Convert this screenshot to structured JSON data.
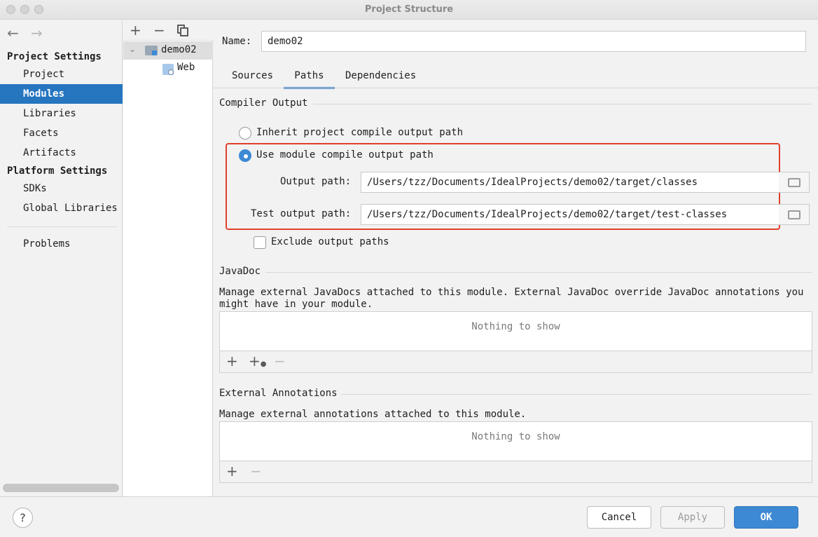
{
  "window": {
    "title": "Project Structure"
  },
  "sidebar": {
    "project_settings_heading": "Project Settings",
    "project_items": [
      "Project",
      "Modules",
      "Libraries",
      "Facets",
      "Artifacts"
    ],
    "platform_settings_heading": "Platform Settings",
    "platform_items": [
      "SDKs",
      "Global Libraries"
    ],
    "problems_label": "Problems",
    "selected": "Modules"
  },
  "module_tree": {
    "root": "demo02",
    "child": "Web"
  },
  "main": {
    "name_label": "Name:",
    "name_value": "demo02",
    "tabs": [
      "Sources",
      "Paths",
      "Dependencies"
    ],
    "selected_tab": "Paths",
    "compiler_output": {
      "title": "Compiler Output",
      "inherit_label": "Inherit project compile output path",
      "use_module_label": "Use module compile output path",
      "selected_option": "use_module",
      "output_path_label": "Output path:",
      "output_path_value": "/Users/tzz/Documents/IdealProjects/demo02/target/classes",
      "test_output_path_label": "Test output path:",
      "test_output_path_value": "/Users/tzz/Documents/IdealProjects/demo02/target/test-classes",
      "exclude_label": "Exclude output paths",
      "exclude_checked": false
    },
    "javadoc": {
      "title": "JavaDoc",
      "description_line1": "Manage external JavaDocs attached to this module. External JavaDoc override JavaDoc annotations you",
      "description_line2": "might have in your module.",
      "empty_text": "Nothing to show"
    },
    "external_annotations": {
      "title": "External Annotations",
      "description": "Manage external annotations attached to this module.",
      "empty_text": "Nothing to show"
    }
  },
  "footer": {
    "help_label": "?",
    "cancel_label": "Cancel",
    "apply_label": "Apply",
    "ok_label": "OK"
  },
  "colors": {
    "selection": "#2675bf",
    "accent": "#3d89d4",
    "highlight_box": "#e0412e"
  }
}
